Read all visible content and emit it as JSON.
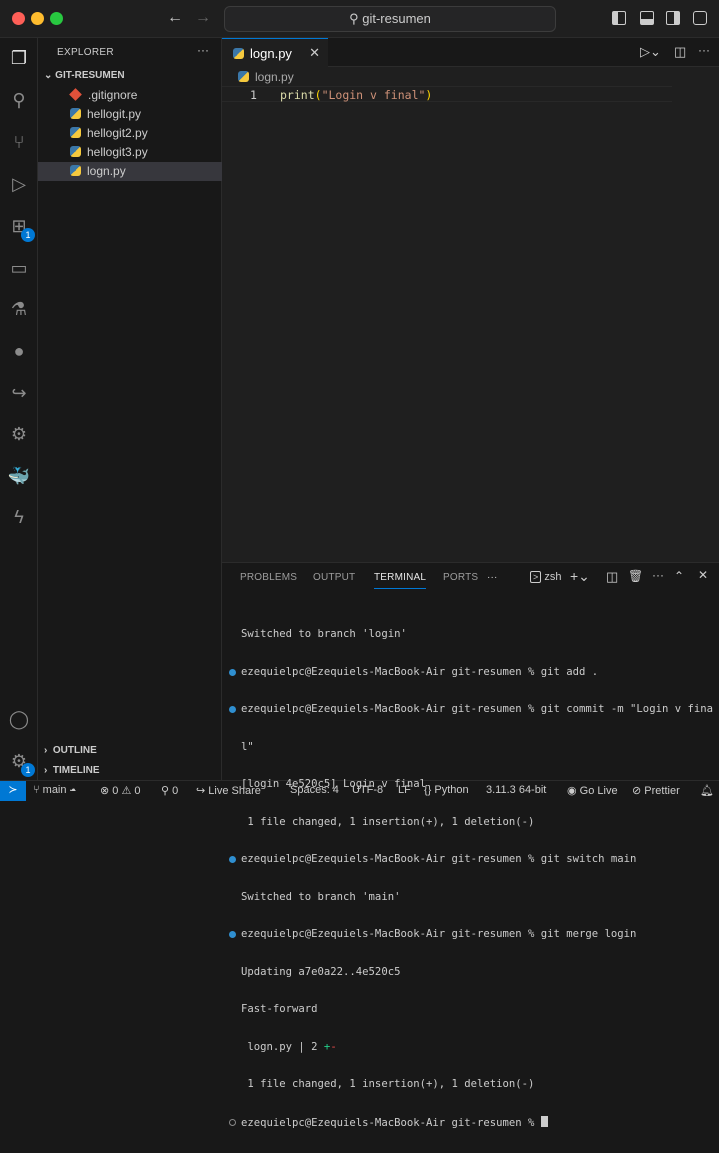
{
  "titlebar": {
    "search_text": "git-resumen",
    "back_icon": "←",
    "forward_icon": "→"
  },
  "activity_bar": {
    "extensions_badge": "1",
    "settings_badge": "1"
  },
  "sidebar": {
    "title": "EXPLORER",
    "more": "···",
    "folder": "GIT-RESUMEN",
    "files": [
      ".gitignore",
      "hellogit.py",
      "hellogit2.py",
      "hellogit3.py",
      "logn.py"
    ],
    "outline": "OUTLINE",
    "timeline": "TIMELINE"
  },
  "editor": {
    "tab_label": "logn.py",
    "breadcrumb": "logn.py",
    "line_number": "1",
    "code": {
      "func": "print",
      "open": "(",
      "string": "\"Login v final\"",
      "close": ")"
    }
  },
  "panel": {
    "tabs": [
      "PROBLEMS",
      "OUTPUT",
      "TERMINAL",
      "PORTS"
    ],
    "more": "···",
    "shell": "zsh",
    "terminal_lines": [
      "Switched to branch 'login'",
      "ezequielpc@Ezequiels-MacBook-Air git-resumen % git add .",
      "ezequielpc@Ezequiels-MacBook-Air git-resumen % git commit -m \"Login v fina",
      "l\"",
      "[login 4e520c5] Login v final",
      " 1 file changed, 1 insertion(+), 1 deletion(-)",
      "ezequielpc@Ezequiels-MacBook-Air git-resumen % git switch main",
      "Switched to branch 'main'",
      "ezequielpc@Ezequiels-MacBook-Air git-resumen % git merge login",
      "Updating a7e0a22..4e520c5",
      "Fast-forward",
      " logn.py | 2 ",
      " 1 file changed, 1 insertion(+), 1 deletion(-)",
      "ezequielpc@Ezequiels-MacBook-Air git-resumen % "
    ],
    "diff_plus": "+",
    "diff_minus": "-"
  },
  "status_bar": {
    "branch": "main",
    "errors": "0",
    "warnings": "0",
    "ports": "0",
    "live_share": "Live Share",
    "spaces": "Spaces: 4",
    "encoding": "UTF-8",
    "eol": "LF",
    "language": "Python",
    "interpreter": "3.11.3 64-bit",
    "go_live": "Go Live",
    "prettier": "Prettier"
  },
  "colors": {
    "accent": "#0078d4",
    "function": "#dcdcaa",
    "string": "#ce9178",
    "bracket": "#ffd700"
  }
}
